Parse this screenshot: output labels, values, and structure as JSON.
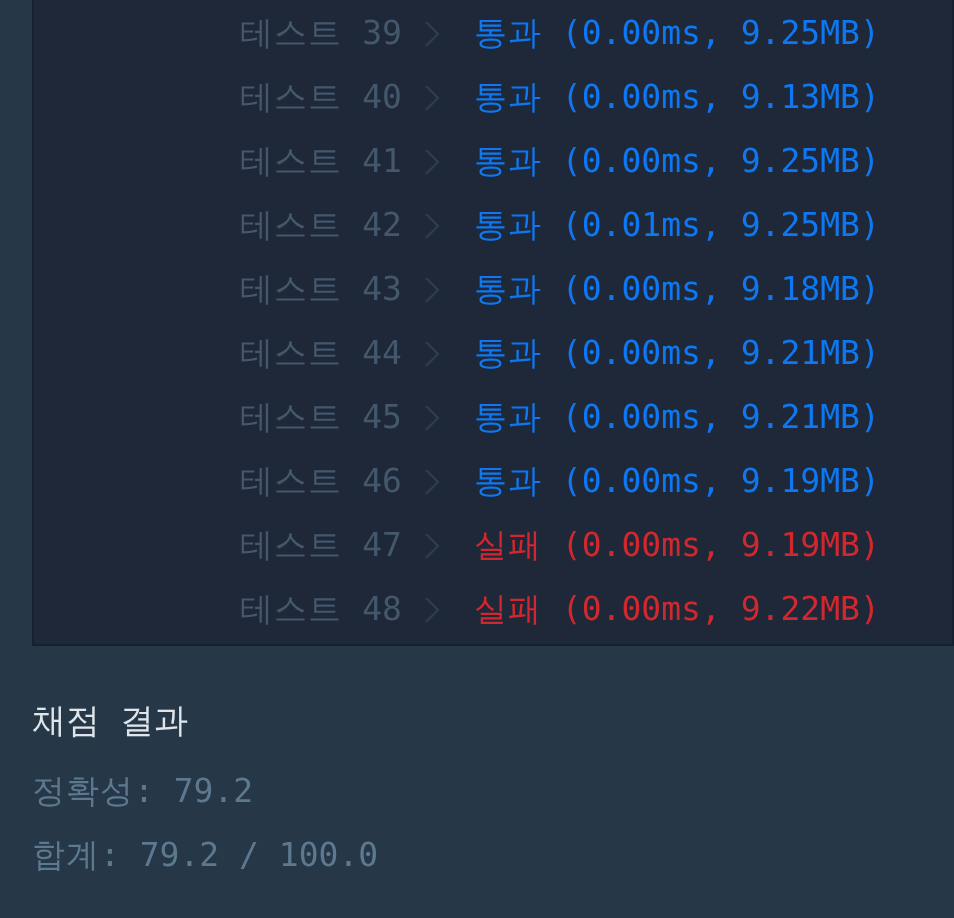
{
  "tests": [
    {
      "label": "테스트 39",
      "result": "통과 (0.00ms, 9.25MB)",
      "passed": true
    },
    {
      "label": "테스트 40",
      "result": "통과 (0.00ms, 9.13MB)",
      "passed": true
    },
    {
      "label": "테스트 41",
      "result": "통과 (0.00ms, 9.25MB)",
      "passed": true
    },
    {
      "label": "테스트 42",
      "result": "통과 (0.01ms, 9.25MB)",
      "passed": true
    },
    {
      "label": "테스트 43",
      "result": "통과 (0.00ms, 9.18MB)",
      "passed": true
    },
    {
      "label": "테스트 44",
      "result": "통과 (0.00ms, 9.21MB)",
      "passed": true
    },
    {
      "label": "테스트 45",
      "result": "통과 (0.00ms, 9.21MB)",
      "passed": true
    },
    {
      "label": "테스트 46",
      "result": "통과 (0.00ms, 9.19MB)",
      "passed": true
    },
    {
      "label": "테스트 47",
      "result": "실패 (0.00ms, 9.19MB)",
      "passed": false
    },
    {
      "label": "테스트 48",
      "result": "실패 (0.00ms, 9.22MB)",
      "passed": false
    }
  ],
  "grading": {
    "title": "채점 결과",
    "accuracy": "정확성: 79.2",
    "total": "합계: 79.2 / 100.0"
  }
}
